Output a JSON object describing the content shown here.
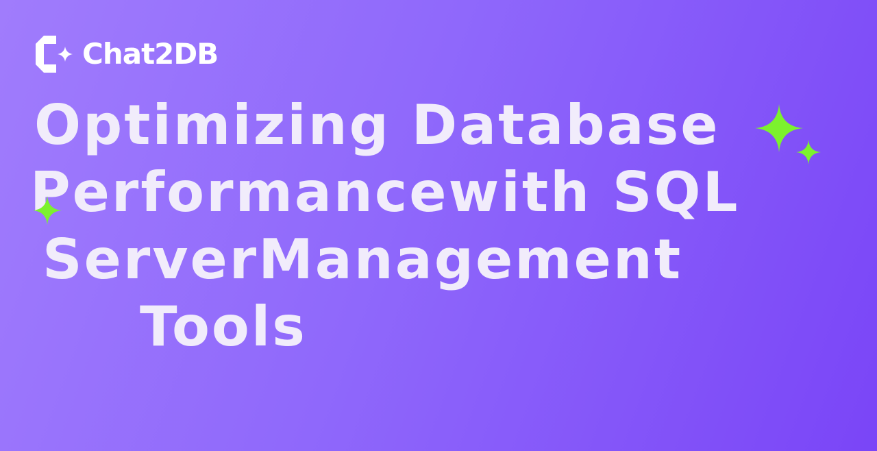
{
  "brand": {
    "name": "Chat2DB",
    "logo_icon": "chat2db-logo-icon"
  },
  "headline": {
    "lines": [
      "Optimizing Database",
      "Performancewith SQL",
      "ServerManagement",
      "Tools"
    ]
  },
  "decorations": {
    "sparkle_icon": "four-point-star-icon",
    "sparkle_color": "#7cf22e"
  },
  "colors": {
    "headline_text": "#f1ecfb",
    "brand_text": "#ffffff",
    "background_start": "#a07cfc",
    "background_end": "#7a45f7"
  }
}
